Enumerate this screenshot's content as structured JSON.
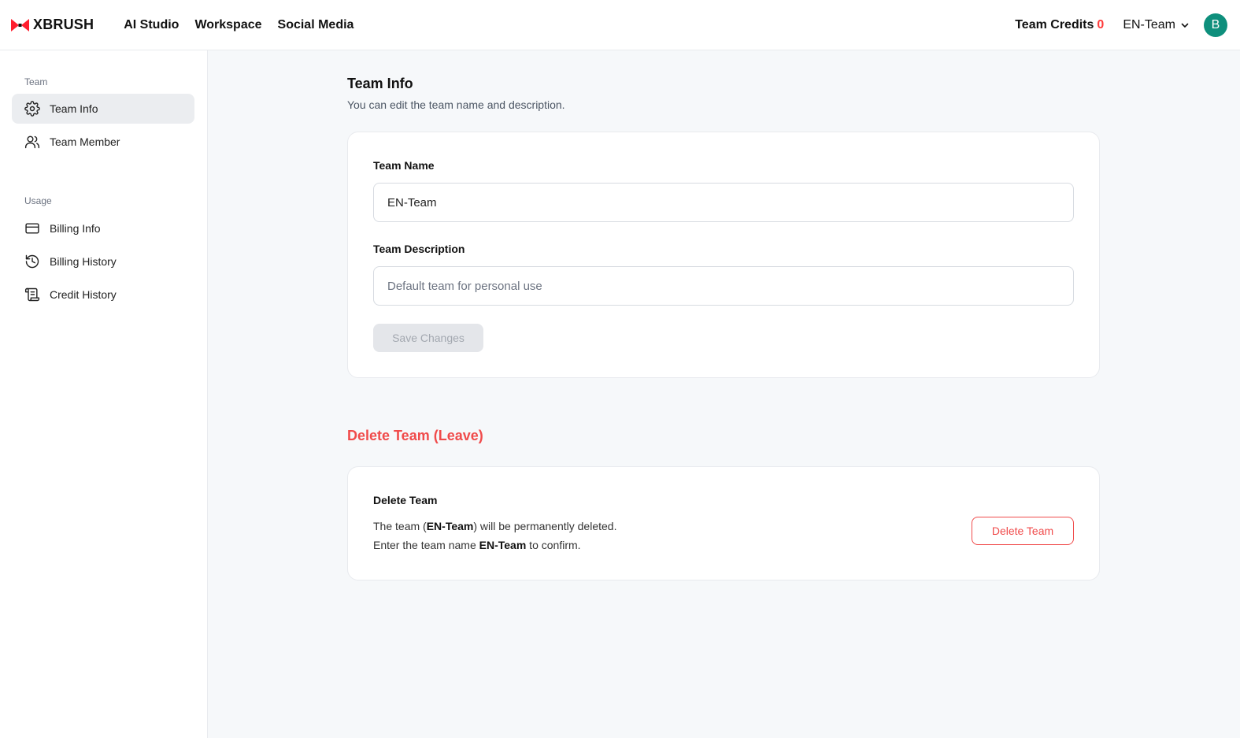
{
  "brand": {
    "name": "XBRUSH",
    "accent": "#ff1f2f"
  },
  "nav": {
    "items": [
      "AI Studio",
      "Workspace",
      "Social Media"
    ]
  },
  "header": {
    "credits_label": "Team Credits",
    "credits_value": "0",
    "team_selector": "EN-Team",
    "avatar_initial": "B"
  },
  "sidebar": {
    "section_team": "Team",
    "section_usage": "Usage",
    "items": [
      {
        "label": "Team Info",
        "icon": "gear-icon",
        "active": true
      },
      {
        "label": "Team Member",
        "icon": "users-icon"
      },
      {
        "label": "Billing Info",
        "icon": "credit-card-icon"
      },
      {
        "label": "Billing History",
        "icon": "history-icon"
      },
      {
        "label": "Credit History",
        "icon": "scroll-icon"
      }
    ]
  },
  "main": {
    "title": "Team Info",
    "subtitle": "You can edit the team name and description.",
    "team_name_label": "Team Name",
    "team_name_value": "EN-Team",
    "team_desc_label": "Team Description",
    "team_desc_placeholder": "Default team for personal use",
    "save_label": "Save Changes"
  },
  "danger": {
    "title": "Delete Team (Leave)",
    "card_title": "Delete Team",
    "line1_prefix": "The team (",
    "line1_team": "EN-Team",
    "line1_suffix": ") will be permanently deleted.",
    "line2_prefix": "Enter the team name ",
    "line2_team": "EN-Team",
    "line2_suffix": " to confirm.",
    "button_label": "Delete Team",
    "color": "#f04b4b"
  }
}
